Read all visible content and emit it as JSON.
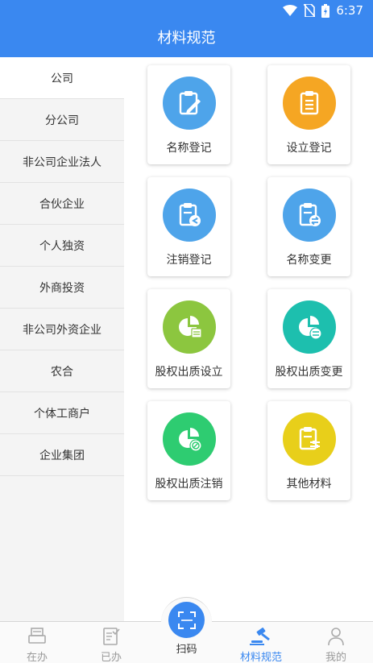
{
  "status": {
    "time": "6:37"
  },
  "header": {
    "title": "材料规范"
  },
  "sidebar": {
    "items": [
      {
        "label": "公司",
        "active": true
      },
      {
        "label": "分公司"
      },
      {
        "label": "非公司企业法人"
      },
      {
        "label": "合伙企业"
      },
      {
        "label": "个人独资"
      },
      {
        "label": "外商投资"
      },
      {
        "label": "非公司外资企业"
      },
      {
        "label": "农合"
      },
      {
        "label": "个体工商户"
      },
      {
        "label": "企业集团"
      }
    ]
  },
  "grid": {
    "items": [
      {
        "label": "名称登记",
        "icon": "clipboard-edit-icon",
        "color": "#4ea4ea"
      },
      {
        "label": "设立登记",
        "icon": "clipboard-list-icon",
        "color": "#f5a623"
      },
      {
        "label": "注销登记",
        "icon": "clipboard-cancel-icon",
        "color": "#4ea4ea"
      },
      {
        "label": "名称变更",
        "icon": "clipboard-exchange-icon",
        "color": "#4ea4ea"
      },
      {
        "label": "股权出质设立",
        "icon": "pie-chart-doc-icon",
        "color": "#8cc63f"
      },
      {
        "label": "股权出质变更",
        "icon": "pie-chart-exchange-icon",
        "color": "#1dbfae"
      },
      {
        "label": "股权出质注销",
        "icon": "pie-chart-cancel-icon",
        "color": "#2ecc71"
      },
      {
        "label": "其他材料",
        "icon": "clipboard-settings-icon",
        "color": "#e8cf1a"
      }
    ]
  },
  "bottom_nav": {
    "tabs": [
      {
        "label": "在办",
        "icon": "printer-icon"
      },
      {
        "label": "已办",
        "icon": "checklist-icon"
      },
      {
        "label": "扫码",
        "icon": "scan-icon"
      },
      {
        "label": "材料规范",
        "icon": "gavel-icon",
        "active": true
      },
      {
        "label": "我的",
        "icon": "person-icon"
      }
    ]
  },
  "colors": {
    "primary": "#3a88f0",
    "sidebar_bg": "#f4f4f4",
    "inactive_tab": "#9a9a9a"
  }
}
